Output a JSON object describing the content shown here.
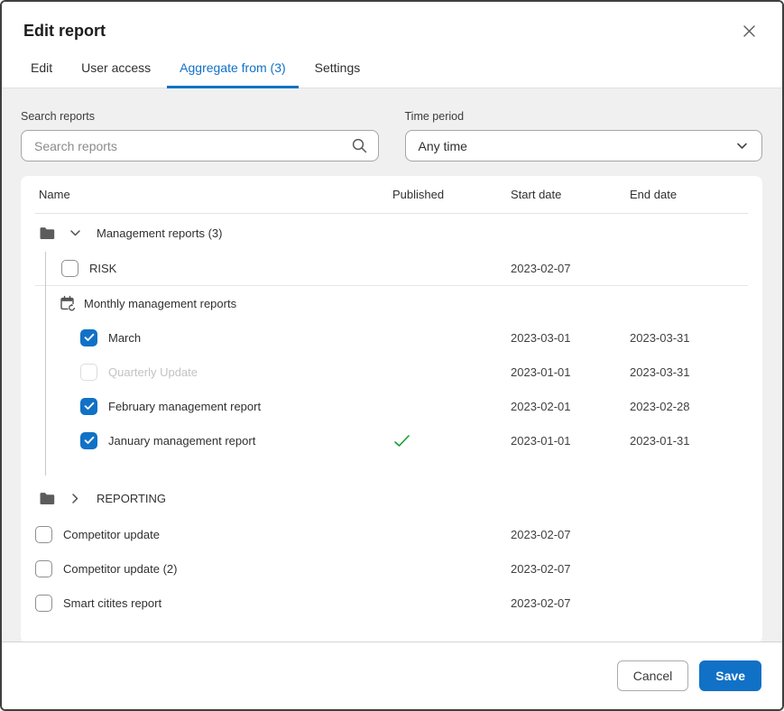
{
  "modal": {
    "title": "Edit report"
  },
  "tabs": [
    {
      "label": "Edit",
      "active": false
    },
    {
      "label": "User access",
      "active": false
    },
    {
      "label": "Aggregate from (3)",
      "active": true
    },
    {
      "label": "Settings",
      "active": false
    }
  ],
  "filters": {
    "search_label": "Search reports",
    "search_placeholder": "Search reports",
    "search_value": "",
    "time_label": "Time period",
    "time_value": "Any time"
  },
  "table": {
    "columns": {
      "name": "Name",
      "published": "Published",
      "start": "Start date",
      "end": "End date"
    },
    "rows": [
      {
        "kind": "folder",
        "label": "Management reports (3)",
        "expanded": true,
        "indent": 0,
        "tree": false
      },
      {
        "kind": "report",
        "label": "RISK",
        "checked": false,
        "disabled": false,
        "published": false,
        "start": "2023-02-07",
        "end": "",
        "indent": 1,
        "tree": true,
        "divider": true
      },
      {
        "kind": "group",
        "label": "Monthly management reports",
        "indent": 1,
        "tree": true
      },
      {
        "kind": "report",
        "label": "March",
        "checked": true,
        "disabled": false,
        "published": false,
        "start": "2023-03-01",
        "end": "2023-03-31",
        "indent": 2,
        "tree": true
      },
      {
        "kind": "report",
        "label": "Quarterly Update",
        "checked": false,
        "disabled": true,
        "published": false,
        "start": "2023-01-01",
        "end": "2023-03-31",
        "indent": 2,
        "tree": true
      },
      {
        "kind": "report",
        "label": "February management report",
        "checked": true,
        "disabled": false,
        "published": false,
        "start": "2023-02-01",
        "end": "2023-02-28",
        "indent": 2,
        "tree": true
      },
      {
        "kind": "report",
        "label": "January management report",
        "checked": true,
        "disabled": false,
        "published": true,
        "start": "2023-01-01",
        "end": "2023-01-31",
        "indent": 2,
        "tree": true
      },
      {
        "kind": "folder",
        "label": "REPORTING",
        "expanded": false,
        "indent": 0,
        "tree": false
      },
      {
        "kind": "report",
        "label": "Competitor update",
        "checked": false,
        "disabled": false,
        "published": false,
        "start": "2023-02-07",
        "end": "",
        "indent": 0,
        "tree": false
      },
      {
        "kind": "report",
        "label": "Competitor update (2)",
        "checked": false,
        "disabled": false,
        "published": false,
        "start": "2023-02-07",
        "end": "",
        "indent": 0,
        "tree": false
      },
      {
        "kind": "report",
        "label": "Smart citites report",
        "checked": false,
        "disabled": false,
        "published": false,
        "start": "2023-02-07",
        "end": "",
        "indent": 0,
        "tree": false
      }
    ]
  },
  "footer": {
    "cancel_label": "Cancel",
    "save_label": "Save"
  },
  "colors": {
    "accent": "#1171c6",
    "published_check": "#149e33",
    "folder_icon": "#5c5c5c",
    "body_bg": "#f0f0f0"
  }
}
